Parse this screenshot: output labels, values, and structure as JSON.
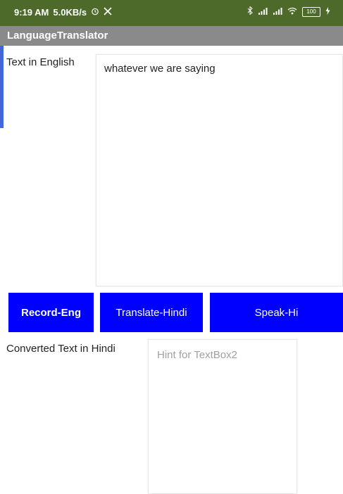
{
  "status_bar": {
    "time": "9:19 AM",
    "speed": "5.0KB/s",
    "battery": "100"
  },
  "app": {
    "title": "LanguageTranslator"
  },
  "english": {
    "label": "Text in English",
    "value": "whatever we are saying"
  },
  "buttons": {
    "record": "Record-Eng",
    "translate": "Translate-Hindi",
    "speak": "Speak-Hi"
  },
  "hindi": {
    "label": "Converted Text in Hindi",
    "placeholder": "Hint for TextBox2"
  },
  "colors": {
    "status_bar": "#4d6a2a",
    "title_bar": "#8a8a8a",
    "button": "#0000ff",
    "button_text": "#ffffff"
  }
}
